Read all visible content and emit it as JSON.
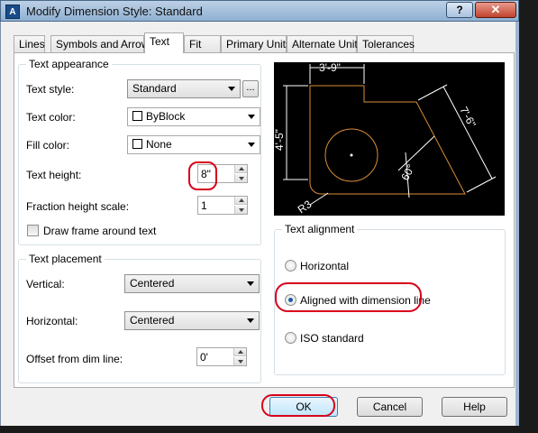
{
  "window": {
    "title": "Modify Dimension Style: Standard",
    "app_icon": "A",
    "help_button": "?",
    "close_button": "✕"
  },
  "tabs": [
    "Lines",
    "Symbols and Arrows",
    "Text",
    "Fit",
    "Primary Units",
    "Alternate Units",
    "Tolerances"
  ],
  "active_tab": "Text",
  "text_appearance": {
    "title": "Text appearance",
    "text_style_label": "Text style:",
    "text_style_value": "Standard",
    "text_style_browse": "...",
    "text_color_label": "Text color:",
    "text_color_value": "ByBlock",
    "fill_color_label": "Fill color:",
    "fill_color_value": "None",
    "text_height_label": "Text height:",
    "text_height_value": "8\"",
    "fraction_height_label": "Fraction height scale:",
    "fraction_height_value": "1",
    "draw_frame_label": "Draw frame around text",
    "draw_frame_checked": false
  },
  "text_placement": {
    "title": "Text placement",
    "vertical_label": "Vertical:",
    "vertical_value": "Centered",
    "horizontal_label": "Horizontal:",
    "horizontal_value": "Centered",
    "offset_label": "Offset from dim line:",
    "offset_value": "0'"
  },
  "text_alignment": {
    "title": "Text alignment",
    "options": [
      "Horizontal",
      "Aligned with dimension line",
      "ISO standard"
    ],
    "selected": "Aligned with dimension line"
  },
  "preview": {
    "dim_top": "3'-9\"",
    "dim_left": "4'-5\"",
    "dim_right": "7'-6\"",
    "dim_angle": "60°",
    "dim_radius": "R3",
    "colors": {
      "background": "#000000",
      "lines": "#ffffff",
      "object": "#d98c3a"
    }
  },
  "buttons": {
    "ok": "OK",
    "cancel": "Cancel",
    "help": "Help"
  },
  "annotation_color": "#d8001a"
}
